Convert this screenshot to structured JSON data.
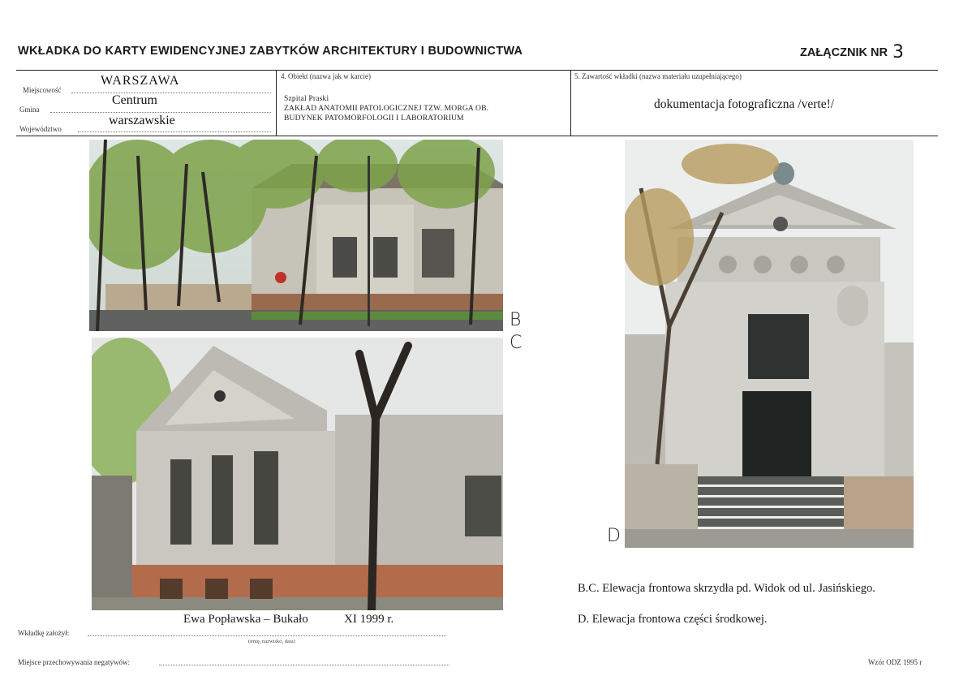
{
  "header": {
    "title": "WKŁADKA DO KARTY EWIDENCYJNEJ ZABYTKÓW ARCHITEKTURY I BUDOWNICTWA",
    "attachment_label": "ZAŁĄCZNIK NR",
    "attachment_number": "3"
  },
  "form": {
    "miejscowosc_label": "Miejscowość",
    "miejscowosc_value": "WARSZAWA",
    "gmina_label": "Gmina",
    "gmina_value": "Centrum",
    "wojewodztwo_label": "Województwo",
    "wojewodztwo_value": "warszawskie",
    "obiekt_label": "4. Obiekt  (nazwa jak w karcie)",
    "obiekt_line1": "Szpital Praski",
    "obiekt_line2": "ZAKŁAD  ANATOMII  PATOLOGICZNEJ  TZW.  MORGA  OB.",
    "obiekt_line3": "BUDYNEK PATOMORFOLOGII I LABORATORIUM",
    "zawartosc_label": "5. Zawartość wkładki  (nazwa materiału uzupełniającego)",
    "zawartosc_value": "dokumentacja fotograficzna /verte!/"
  },
  "photos": {
    "label_b": "B",
    "label_c": "C",
    "label_d": "D"
  },
  "captions": {
    "bc": "B.C. Elewacja frontowa skrzydła pd. Widok od ul. Jasińskiego.",
    "d": "D. Elewacja frontowa części środkowej."
  },
  "footer": {
    "author_value": "Ewa Popławska – Bukało",
    "date_value": "XI 1999 r.",
    "author_label": "Wkładkę założył:",
    "author_hint": "(imię, nazwisko, data)",
    "storage_label": "Miejsce przechowywania negatywów:",
    "template_note": "Wzór ODZ 1995 r"
  }
}
